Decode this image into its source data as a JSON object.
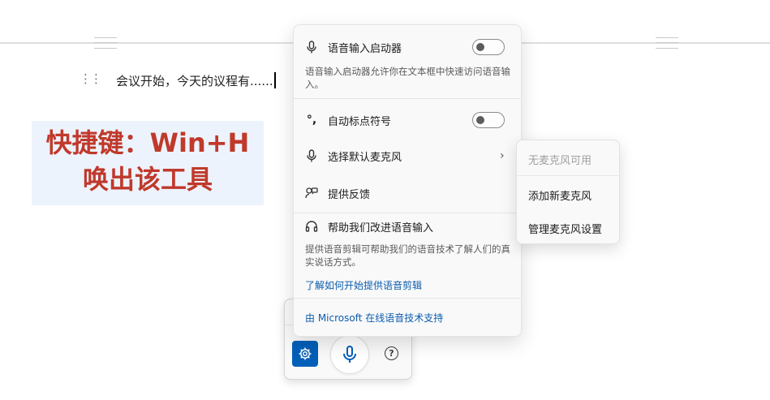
{
  "document": {
    "line_text": "会议开始，今天的议程有......",
    "banner_line1": "快捷键：Win+H",
    "banner_line2": "唤出该工具",
    "banner_color": "#c0392b",
    "banner_bg": "#edf3fc"
  },
  "menu": {
    "launcher_label": "语音输入启动器",
    "launcher_toggle": "off",
    "launcher_desc": "语音输入启动器允许你在文本框中快速访问语音输入。",
    "auto_punct_label": "自动标点符号",
    "auto_punct_toggle": "off",
    "mic_label": "选择默认麦克风",
    "feedback_label": "提供反馈",
    "improve_label": "帮助我们改进语音输入",
    "improve_desc": "提供语音剪辑可帮助我们的语音技术了解人们的真实说话方式。",
    "learn_link": "了解如何开始提供语音剪辑",
    "powered_link": "由 Microsoft 在线语音技术支持"
  },
  "submenu": {
    "no_mic": "无麦克风可用",
    "add_mic": "添加新麦克风",
    "manage_mic": "管理麦克风设置"
  },
  "toolbar": {
    "accent_color": "#005fb8",
    "help_glyph": "?"
  }
}
